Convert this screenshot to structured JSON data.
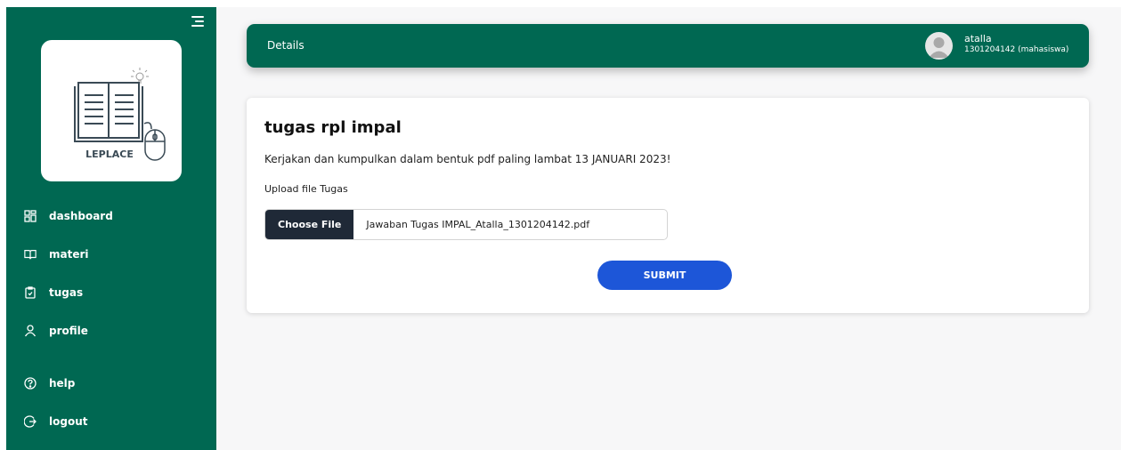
{
  "sidebar": {
    "logo_text": "LEPLACE",
    "items": [
      {
        "label": "dashboard",
        "icon": "dashboard-icon"
      },
      {
        "label": "materi",
        "icon": "book-icon"
      },
      {
        "label": "tugas",
        "icon": "clipboard-icon"
      },
      {
        "label": "profile",
        "icon": "user-icon"
      },
      {
        "label": "help",
        "icon": "help-icon"
      },
      {
        "label": "logout",
        "icon": "logout-icon"
      }
    ]
  },
  "header": {
    "title": "Details",
    "user_name": "atalla",
    "user_id": "1301204142 (mahasiswa)"
  },
  "task": {
    "title": "tugas rpl impal",
    "description": "Kerjakan dan kumpulkan dalam bentuk pdf paling lambat 13 JANUARI 2023!",
    "upload_label": "Upload file Tugas",
    "choose_file_label": "Choose File",
    "file_name": "Jawaban Tugas IMPAL_Atalla_1301204142.pdf",
    "submit_label": "SUBMIT"
  },
  "colors": {
    "brand_green": "#006852",
    "submit_blue": "#1d56d8",
    "file_button": "#1f2937"
  }
}
